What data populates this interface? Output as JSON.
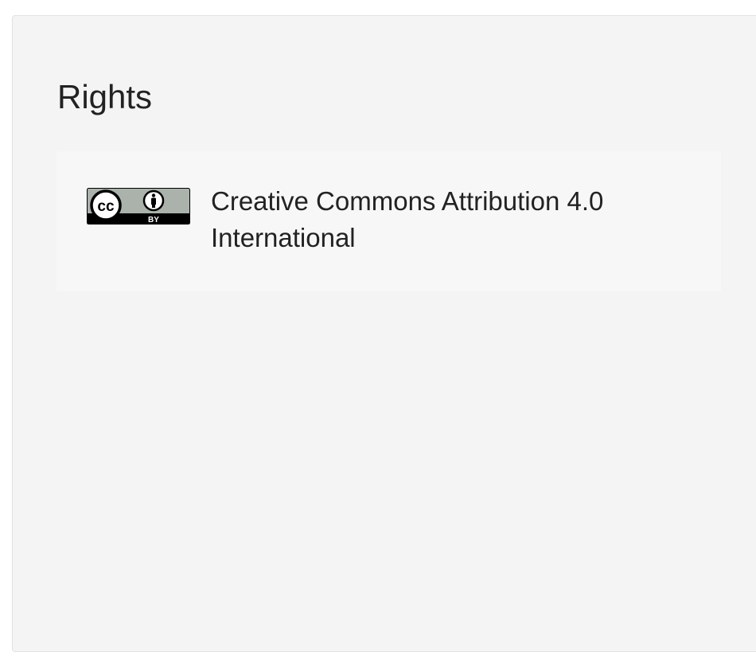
{
  "rights": {
    "title": "Rights",
    "license": {
      "badge_icon": "cc-by-icon",
      "badge_cc_text": "cc",
      "badge_by_text": "BY",
      "label": "Creative Commons Attribution 4.0 International"
    }
  },
  "colors": {
    "panel_bg": "#f4f4f4",
    "card_bg": "#f7f7f7",
    "text": "#222222",
    "badge_gray": "#aab2ab"
  }
}
